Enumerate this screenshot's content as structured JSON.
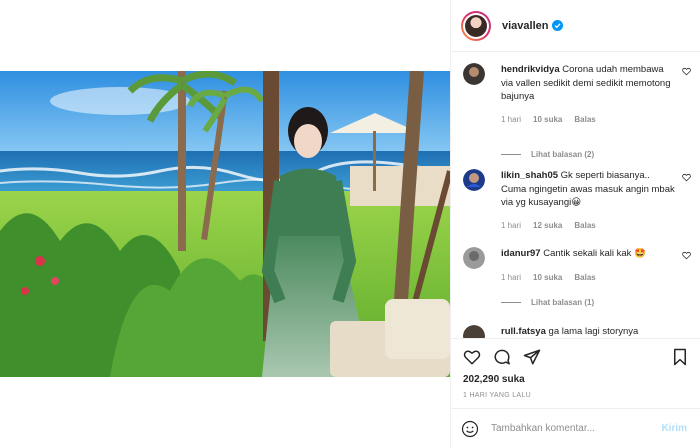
{
  "post": {
    "username": "viavallen",
    "verified": true,
    "photo_description_icon": "beach-photo"
  },
  "comments": [
    {
      "user": "hendrikvidya",
      "text": "Corona udah membawa via vallen sedikit demi sedikit memotong bajunya",
      "time": "1 hari",
      "likes": "10 suka",
      "reply": "Balas",
      "replies_label": "Lihat balasan (2)"
    },
    {
      "user": "likin_shah05",
      "text": "Gk seperti biasanya.. Cuma ngingetin awas masuk angin mbak via yg kusayangi😀",
      "time": "1 hari",
      "likes": "12 suka",
      "reply": "Balas",
      "replies_label": ""
    },
    {
      "user": "idanur97",
      "text": "Cantik sekali kali kak 🤩",
      "time": "1 hari",
      "likes": "10 suka",
      "reply": "Balas",
      "replies_label": "Lihat balasan (1)"
    },
    {
      "user": "rull.fatsya",
      "text": "ga lama lagi storynya",
      "time": "",
      "likes": "",
      "reply": "",
      "replies_label": ""
    }
  ],
  "likes_count": "202,290 suka",
  "timestamp": "1 HARI YANG LALU",
  "comment_box": {
    "placeholder": "Tambahkan komentar...",
    "post_label": "Kirim"
  },
  "colors": {
    "accent_blue": "#0095f6",
    "post_disabled": "#b2dffc",
    "meta_gray": "#8e8e8e"
  }
}
